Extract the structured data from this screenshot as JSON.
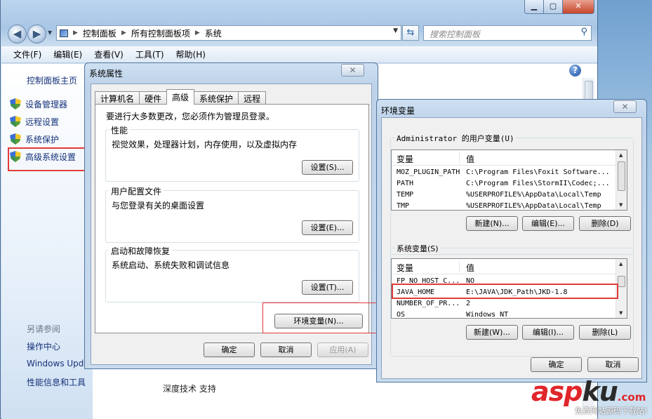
{
  "control_panel": {
    "address": {
      "crumbs": [
        "控制面板",
        "所有控制面板项",
        "系统"
      ]
    },
    "search_placeholder": "搜索控制面板",
    "menu": [
      "文件(F)",
      "编辑(E)",
      "查看(V)",
      "工具(T)",
      "帮助(H)"
    ],
    "sidebar": {
      "home": "控制面板主页",
      "links": [
        "设备管理器",
        "远程设置",
        "系统保护",
        "高级系统设置"
      ],
      "see_also": "另请参阅",
      "bottom_links": [
        "操作中心",
        "Windows Upd",
        "性能信息和工具"
      ]
    },
    "main_footer_text": "深度技术 支持"
  },
  "system_properties": {
    "title": "系统属性",
    "tabs": [
      "计算机名",
      "硬件",
      "高级",
      "系统保护",
      "远程"
    ],
    "active_tab": "高级",
    "admin_note": "要进行大多数更改，您必须作为管理员登录。",
    "groups": [
      {
        "title": "性能",
        "desc": "视觉效果，处理器计划，内存使用，以及虚拟内存",
        "button": "设置(S)..."
      },
      {
        "title": "用户配置文件",
        "desc": "与您登录有关的桌面设置",
        "button": "设置(E)..."
      },
      {
        "title": "启动和故障恢复",
        "desc": "系统启动、系统失败和调试信息",
        "button": "设置(T)..."
      }
    ],
    "env_button": "环境变量(N)...",
    "ok": "确定",
    "cancel": "取消",
    "apply": "应用(A)"
  },
  "environment_variables": {
    "title": "环境变量",
    "user_group_title": "Administrator 的用户变量(U)",
    "user_columns": [
      "变量",
      "值"
    ],
    "user_rows": [
      {
        "name": "MOZ_PLUGIN_PATH",
        "value": "C:\\Program Files\\Foxit Software..."
      },
      {
        "name": "PATH",
        "value": "C:\\Program Files\\StormII\\Codec;..."
      },
      {
        "name": "TEMP",
        "value": "%USERPROFILE%\\AppData\\Local\\Temp"
      },
      {
        "name": "TMP",
        "value": "%USERPROFILE%\\AppData\\Local\\Temp"
      }
    ],
    "user_buttons": [
      "新建(N)...",
      "编辑(E)...",
      "删除(D)"
    ],
    "system_group_title": "系统变量(S)",
    "system_columns": [
      "变量",
      "值"
    ],
    "system_rows": [
      {
        "name": "FP_NO_HOST_C...",
        "value": "NO"
      },
      {
        "name": "JAVA_HOME",
        "value": "E:\\JAVA\\JDK_Path\\JKD-1.8"
      },
      {
        "name": "NUMBER_OF_PR...",
        "value": "2"
      },
      {
        "name": "OS",
        "value": "Windows_NT"
      }
    ],
    "system_buttons": [
      "新建(W)...",
      "编辑(I)...",
      "删除(L)"
    ],
    "ok": "确定",
    "cancel": "取消"
  },
  "watermark": {
    "logo_left": "asp",
    "logo_right": "ku",
    "logo_suffix": ".com",
    "tagline": "免费网站源码下载站!"
  },
  "colors": {
    "highlight": "#e33a3a",
    "link": "#15327a"
  }
}
